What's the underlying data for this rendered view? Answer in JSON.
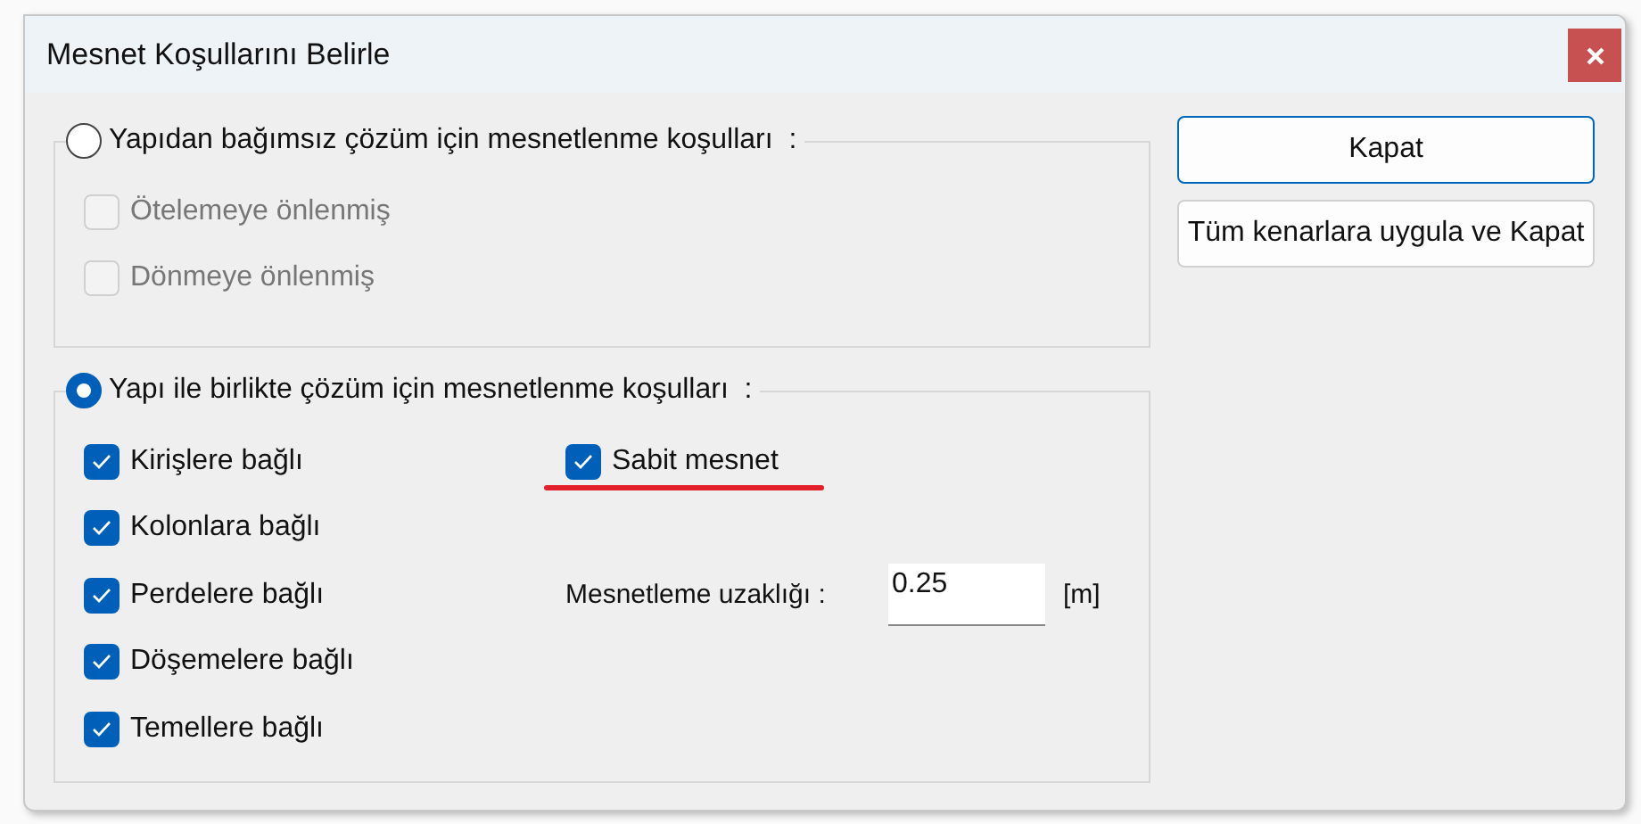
{
  "window": {
    "title": "Mesnet Koşullarını Belirle"
  },
  "groups": [
    {
      "label": "Yapıdan bağımsız çözüm için mesnetlenme koşulları  :",
      "selected": false,
      "options": [
        {
          "label": "Ötelemeye önlenmiş",
          "checked": false,
          "disabled": true
        },
        {
          "label": "Dönmeye önlenmiş",
          "checked": false,
          "disabled": true
        }
      ]
    },
    {
      "label": "Yapı ile birlikte çözüm için mesnetlenme koşulları  :",
      "selected": true,
      "options": [
        {
          "label": "Kirişlere bağlı",
          "checked": true,
          "disabled": false
        },
        {
          "label": "Kolonlara bağlı",
          "checked": true,
          "disabled": false
        },
        {
          "label": "Perdelere bağlı",
          "checked": true,
          "disabled": false
        },
        {
          "label": "Döşemelere bağlı",
          "checked": true,
          "disabled": false
        },
        {
          "label": "Temellere bağlı",
          "checked": true,
          "disabled": false
        }
      ],
      "fixed_support": {
        "label": "Sabit mesnet",
        "checked": true,
        "underlined": true
      },
      "distance": {
        "label": "Mesnetleme uzaklığı :",
        "value": "0.25",
        "unit": "[m]"
      }
    }
  ],
  "buttons": [
    {
      "label": "Kapat",
      "default": true
    },
    {
      "label": "Tüm kenarlara uygula ve Kapat",
      "default": false
    }
  ]
}
